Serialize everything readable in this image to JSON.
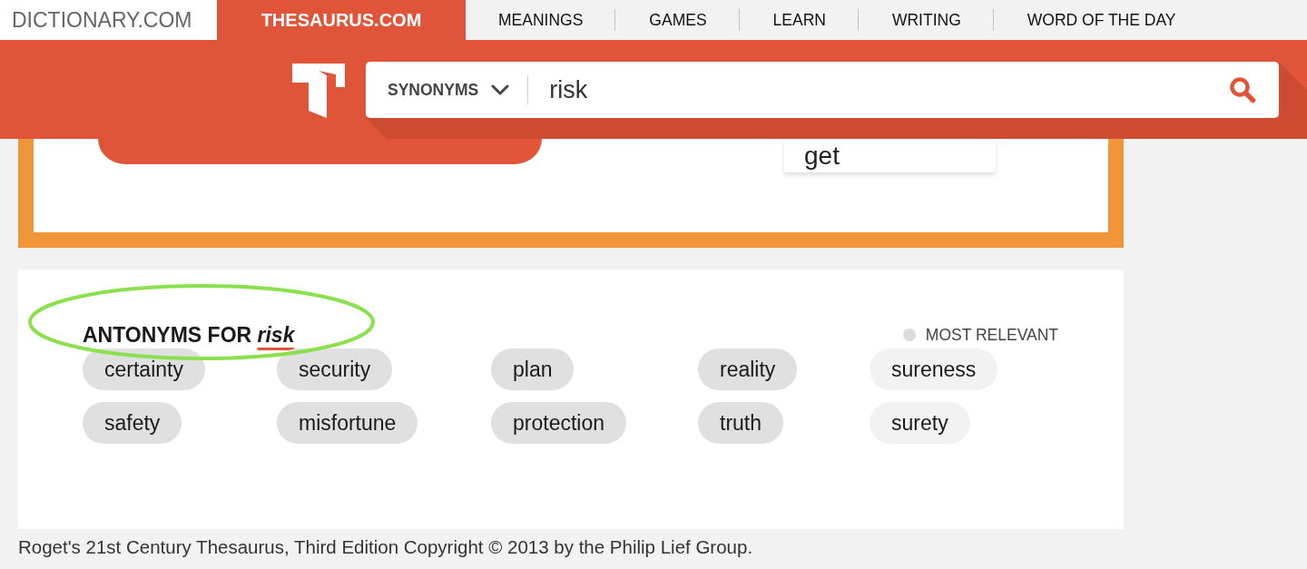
{
  "top_nav": {
    "sites": [
      {
        "label": "DICTIONARY.COM",
        "selected": false
      },
      {
        "label": "THESAURUS.COM",
        "selected": true
      }
    ],
    "links": [
      "MEANINGS",
      "GAMES",
      "LEARN",
      "WRITING",
      "WORD OF THE DAY"
    ]
  },
  "search": {
    "mode": "SYNONYMS",
    "value": "risk"
  },
  "featured": {
    "word": "get"
  },
  "antonyms": {
    "heading": "ANTONYMS FOR *risk*",
    "circled": true,
    "legend": "MOST RELEVANT",
    "words": [
      {
        "label": "certainty",
        "color": "#e0e0e0"
      },
      {
        "label": "security",
        "color": "#e0e0e0"
      },
      {
        "label": "plan",
        "color": "#e0e0e0"
      },
      {
        "label": "reality",
        "color": "#e0e0e0"
      },
      {
        "label": "sureness",
        "color": "#f2f2f2"
      },
      {
        "label": "safety",
        "color": "#e0e0e0"
      },
      {
        "label": "misfortune",
        "color": "#e0e0e0"
      },
      {
        "label": "protection",
        "color": "#e0e0e0"
      },
      {
        "label": "truth",
        "color": "#e0e0e0"
      },
      {
        "label": "surety",
        "color": "#f2f2f2"
      }
    ]
  },
  "footer": "Roget's 21st Century Thesaurus, Third Edition Copyright © 2013 by the Philip Lief Group."
}
